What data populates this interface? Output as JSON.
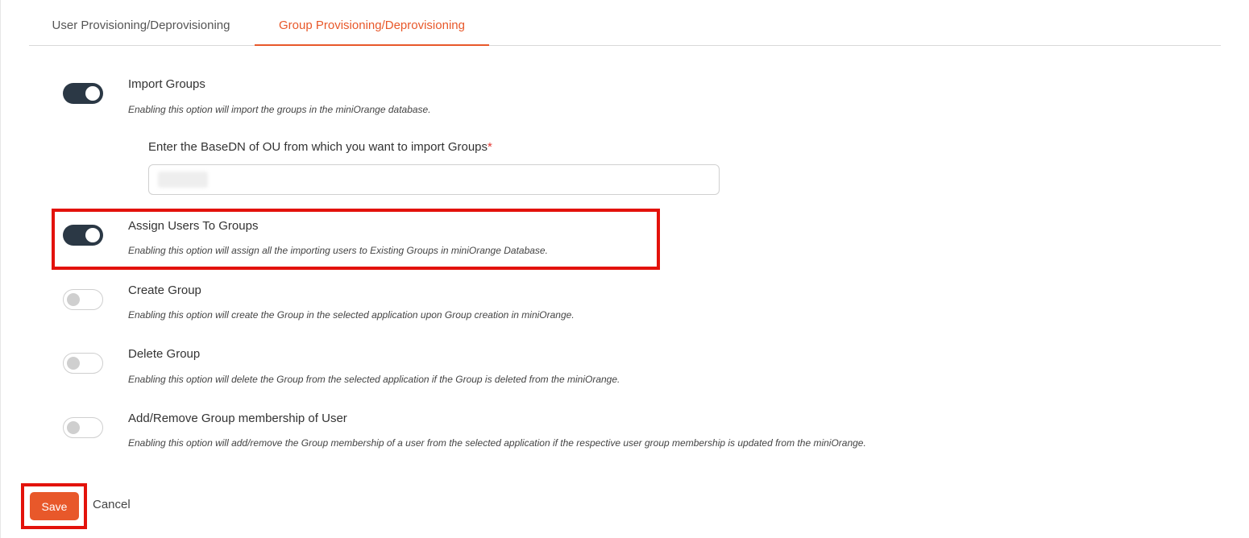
{
  "tabs": [
    {
      "label": "User Provisioning/Deprovisioning",
      "active": false
    },
    {
      "label": "Group Provisioning/Deprovisioning",
      "active": true
    }
  ],
  "options": {
    "import_groups": {
      "title": "Import Groups",
      "description": "Enabling this option will import the groups in the miniOrange database.",
      "enabled": true
    },
    "assign_users": {
      "title": "Assign Users To Groups",
      "description": "Enabling this option will assign all the importing users to Existing Groups in miniOrange Database.",
      "enabled": true
    },
    "create_group": {
      "title": "Create Group",
      "description": "Enabling this option will create the Group in the selected application upon Group creation in miniOrange.",
      "enabled": false
    },
    "delete_group": {
      "title": "Delete Group",
      "description": "Enabling this option will delete the Group from the selected application if the Group is deleted from the miniOrange.",
      "enabled": false
    },
    "group_membership": {
      "title": "Add/Remove Group membership of User",
      "description": "Enabling this option will add/remove the Group membership of a user from the selected application if the respective user group membership is updated from the miniOrange.",
      "enabled": false
    }
  },
  "basedn": {
    "label": "Enter the BaseDN of OU from which you want to import Groups",
    "required_marker": "*",
    "value": ""
  },
  "actions": {
    "save_label": "Save",
    "cancel_label": "Cancel"
  },
  "colors": {
    "accent": "#e8582a",
    "toggle_on": "#2b3845",
    "highlight": "#e3120b"
  }
}
